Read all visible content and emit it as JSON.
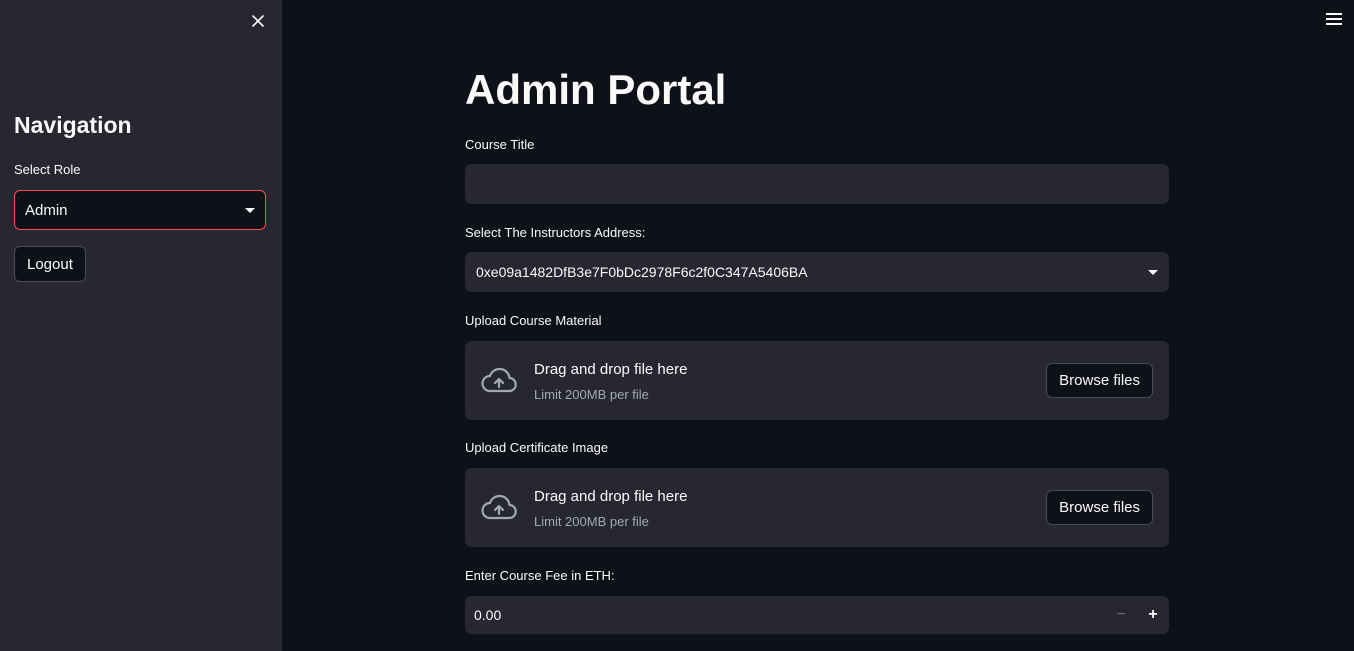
{
  "sidebar": {
    "title": "Navigation",
    "role_label": "Select Role",
    "role_value": "Admin",
    "logout_label": "Logout"
  },
  "main": {
    "title": "Admin Portal",
    "course_title": {
      "label": "Course Title",
      "value": ""
    },
    "instructor": {
      "label": "Select The Instructors Address:",
      "value": "0xe09a1482DfB3e7F0bDc2978F6c2f0C347A5406BA"
    },
    "course_material": {
      "label": "Upload Course Material",
      "drop_text": "Drag and drop file here",
      "limit_text": "Limit 200MB per file",
      "button_label": "Browse files"
    },
    "certificate_image": {
      "label": "Upload Certificate Image",
      "drop_text": "Drag and drop file here",
      "limit_text": "Limit 200MB per file",
      "button_label": "Browse files"
    },
    "course_fee": {
      "label": "Enter Course Fee in ETH:",
      "value": "0.00",
      "minus_label": "−",
      "plus_label": "+"
    }
  },
  "icons": {
    "close": "close-icon",
    "menu": "hamburger-menu-icon",
    "upload": "cloud-upload-icon",
    "dropdown": "chevron-down-icon"
  },
  "colors": {
    "accent": "#ff4b4b",
    "background": "#0e1117",
    "sidebar": "#262730",
    "input": "#262730"
  }
}
